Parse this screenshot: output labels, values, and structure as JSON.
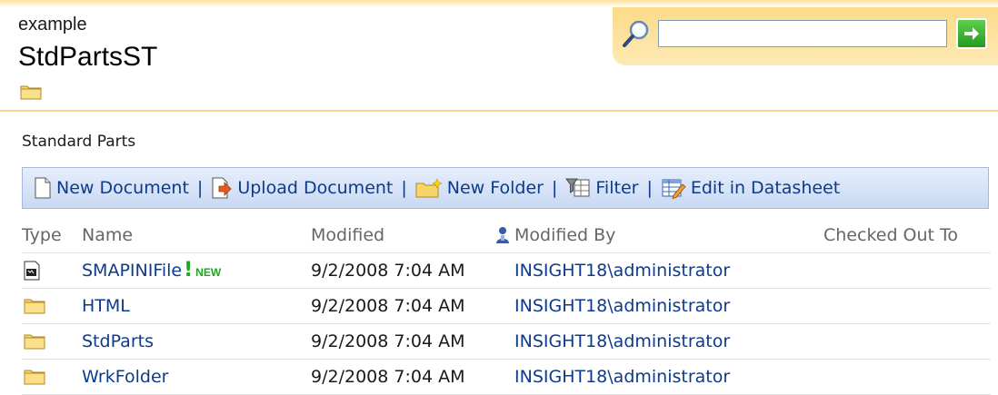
{
  "header": {
    "breadcrumb": "example",
    "title": "StdPartsST",
    "folder_icon": "folder-icon",
    "accent_color": "#fbdb8a"
  },
  "search": {
    "placeholder": "",
    "value": "",
    "search_icon": "magnifier-icon",
    "go_icon": "arrow-right-icon"
  },
  "list": {
    "title": "Standard Parts"
  },
  "toolbar": {
    "new_document": "New Document",
    "upload_document": "Upload Document",
    "new_folder": "New Folder",
    "filter": "Filter",
    "edit_datasheet": "Edit in Datasheet",
    "separator": "|"
  },
  "table": {
    "headers": {
      "type": "Type",
      "name": "Name",
      "modified": "Modified",
      "modified_by": "Modified By",
      "checked_out_to": "Checked Out To"
    },
    "rows": [
      {
        "type_icon": "document-icon",
        "name": "SMAPINIFile",
        "new_badge": "!",
        "new_label": "NEW",
        "modified": "9/2/2008 7:04 AM",
        "modified_by": "INSIGHT18\\administrator",
        "checked_out_to": ""
      },
      {
        "type_icon": "folder-icon",
        "name": "HTML",
        "modified": "9/2/2008 7:04 AM",
        "modified_by": "INSIGHT18\\administrator",
        "checked_out_to": ""
      },
      {
        "type_icon": "folder-icon",
        "name": "StdParts",
        "modified": "9/2/2008 7:04 AM",
        "modified_by": "INSIGHT18\\administrator",
        "checked_out_to": ""
      },
      {
        "type_icon": "folder-icon",
        "name": "WrkFolder",
        "modified": "9/2/2008 7:04 AM",
        "modified_by": "INSIGHT18\\administrator",
        "checked_out_to": ""
      }
    ]
  }
}
